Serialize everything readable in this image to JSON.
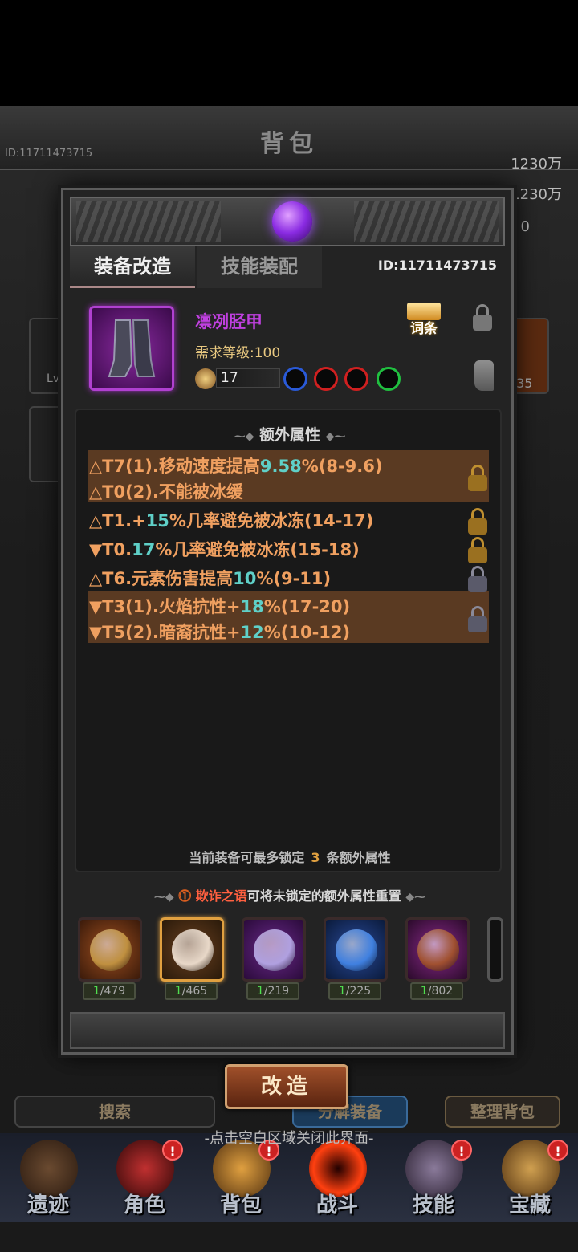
{
  "background": {
    "title": "背包",
    "player_id": "ID:11711473715",
    "gold": "1230万",
    "diamond": "1230万",
    "third_value": "0",
    "search_label": "搜索",
    "decompose_label": "分解装备",
    "sort_label": "整理背包",
    "slot_level_label": "Lv",
    "slot_value": ".35"
  },
  "nav": [
    {
      "label": "遗迹",
      "badge": ""
    },
    {
      "label": "角色",
      "badge": "!"
    },
    {
      "label": "背包",
      "badge": "!"
    },
    {
      "label": "战斗",
      "badge": ""
    },
    {
      "label": "技能",
      "badge": "!"
    },
    {
      "label": "宝藏",
      "badge": "!"
    }
  ],
  "dialog": {
    "tabs": [
      "装备改造",
      "技能装配"
    ],
    "id_text": "ID:11711473715",
    "item": {
      "name": "凛冽胫甲",
      "required_level": "需求等级:100",
      "gear_score": "17",
      "sockets": [
        "#2a5ad8",
        "#d02020",
        "#d02020",
        "#20c040"
      ],
      "entry_label": "词条"
    },
    "attributes_title": "额外属性",
    "attributes": [
      {
        "pre": "△T7(1).移动速度提高",
        "num": "9.58",
        "post": "%(8-9.6)"
      },
      {
        "pre": "△T0(2).不能被冰缓",
        "num": "",
        "post": ""
      },
      {
        "pre": "△T1.+",
        "num": "15",
        "post": "%几率避免被冰冻(14-17)"
      },
      {
        "pre": "▼T0.",
        "num": "17",
        "post": "%几率避免被冰冻(15-18)"
      },
      {
        "pre": "△T6.元素伤害提高",
        "num": "10",
        "post": "%(9-11)"
      },
      {
        "pre": "▼T3(1).火焰抗性+",
        "num": "18",
        "post": "%(17-20)"
      },
      {
        "pre": "▼T5(2).暗裔抗性+",
        "num": "12",
        "post": "%(10-12)"
      }
    ],
    "lock_limit": {
      "pre": "当前装备可最多锁定",
      "num": "3",
      "post": "条额外属性"
    },
    "material_hint": {
      "name": "欺诈之语",
      "text": "可将未锁定的额外属性重置"
    },
    "materials": [
      {
        "have": "1",
        "total": "/479",
        "color": "#c09040"
      },
      {
        "have": "1",
        "total": "/465",
        "color": "#e8d8c8"
      },
      {
        "have": "1",
        "total": "/219",
        "color": "#b0a0e0"
      },
      {
        "have": "1",
        "total": "/225",
        "color": "#4080e0"
      },
      {
        "have": "1",
        "total": "/802",
        "color": "#a05030"
      }
    ]
  },
  "forge_button": "改造",
  "close_hint": "-点击空白区域关闭此界面-"
}
